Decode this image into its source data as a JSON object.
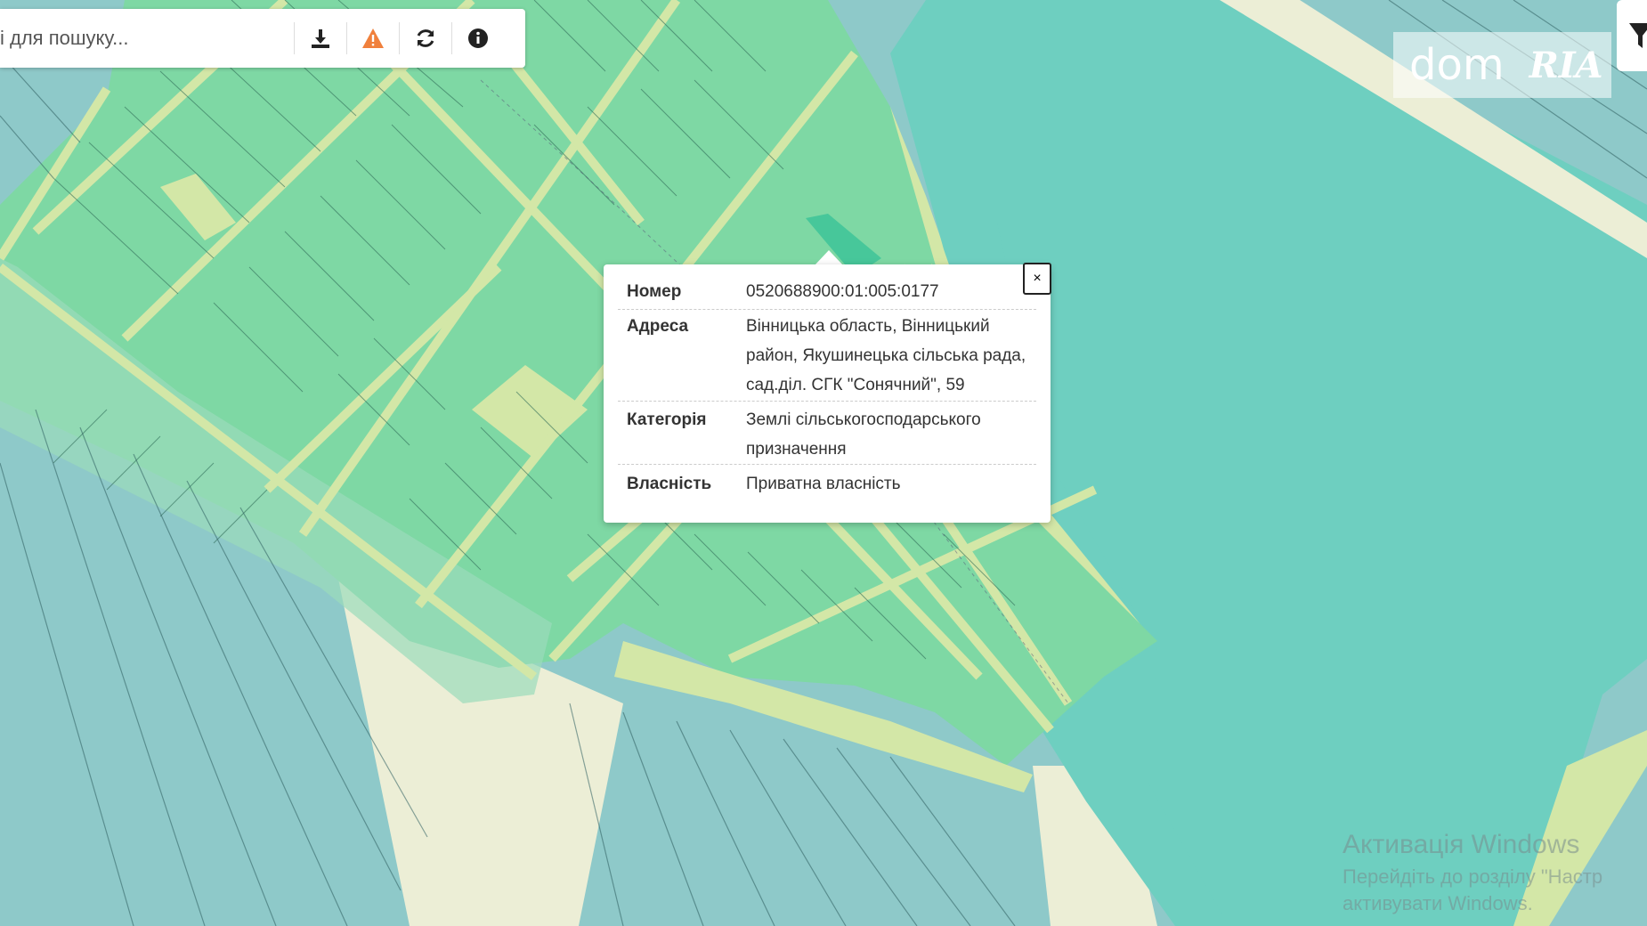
{
  "search": {
    "placeholder": "і для пошуку..."
  },
  "toolbar": {
    "icons": [
      "download-icon",
      "warning-icon",
      "refresh-icon",
      "info-icon"
    ],
    "warning_color": "#f0803c"
  },
  "popup": {
    "close_label": "×",
    "rows": [
      {
        "label": "Номер",
        "value": "0520688900:01:005:0177"
      },
      {
        "label": "Адреса",
        "value": "Вінницька область, Вінницький район, Якушинецька сільська рада, сад.діл. СГК \"Сонячний\", 59"
      },
      {
        "label": "Категорія",
        "value": "Землі сільськогосподарського призначення"
      },
      {
        "label": "Власність",
        "value": "Приватна власність"
      }
    ]
  },
  "logo": {
    "left": "dom",
    "right": "RIA"
  },
  "watermark": {
    "line1": "Активація Windows",
    "line2": "Перейдіть до розділу \"Настр",
    "line3": "активувати Windows."
  },
  "colors": {
    "water": "#6ecfc0",
    "parcels": "#7ed8a4",
    "farmland": "#8ec9c9",
    "empty": "#eceed6",
    "road": "#d3e7a7",
    "selected": "#47c79a"
  }
}
